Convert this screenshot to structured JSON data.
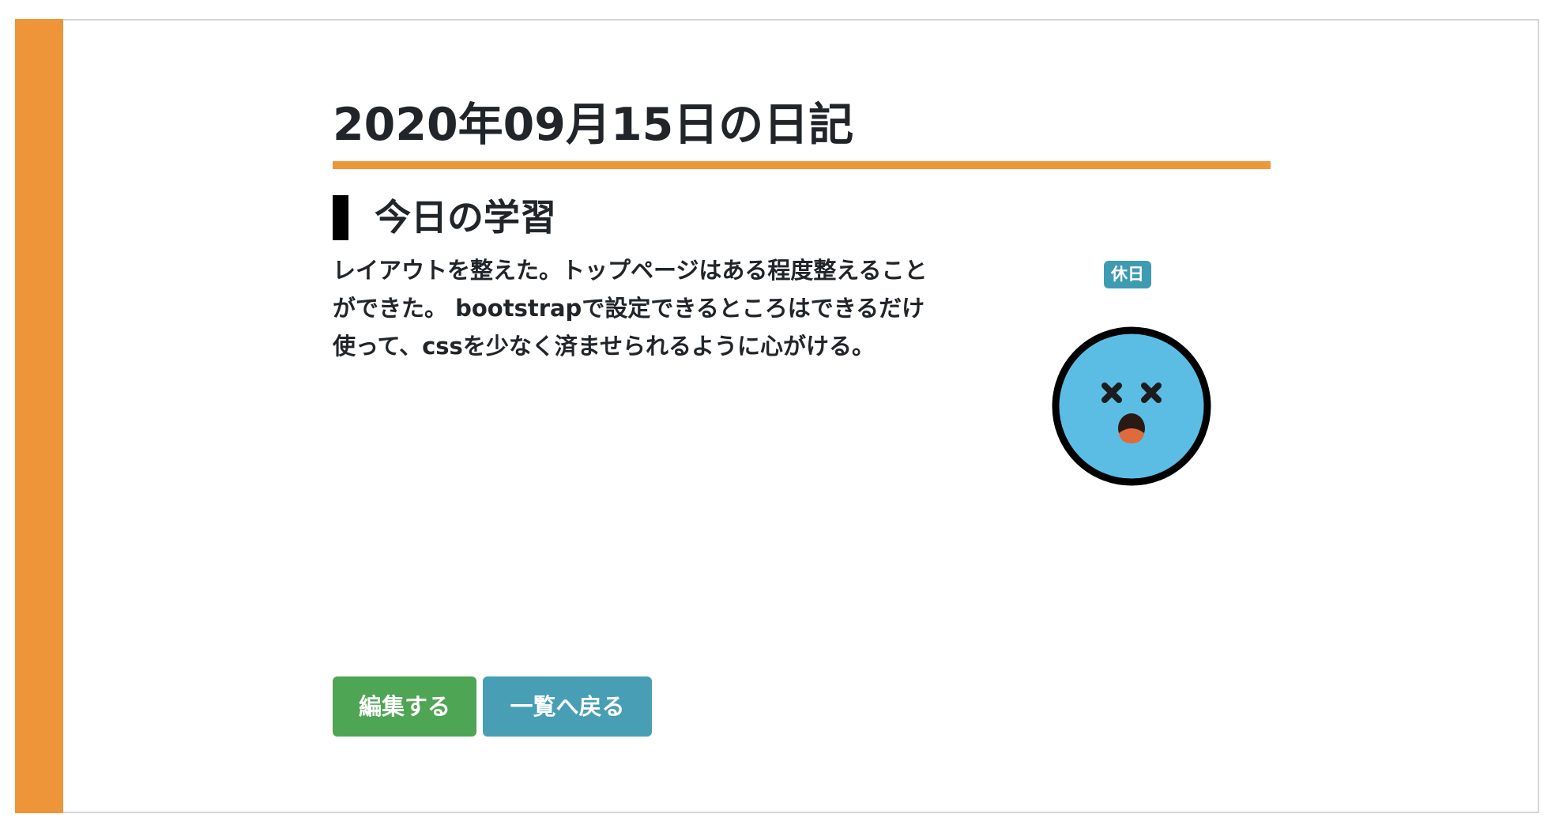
{
  "page": {
    "title": "2020年09月15日の日記"
  },
  "section": {
    "heading": "今日の学習",
    "body": "レイアウトを整えた。トップページはある程度整えることができた。 bootstrapで設定できるところはできるだけ使って、cssを少なく済ませられるように心がける。"
  },
  "status": {
    "badge": "休日",
    "mood_icon": "dizzy-face-icon"
  },
  "actions": {
    "edit_label": "編集する",
    "back_label": "一覧へ戻る"
  },
  "colors": {
    "accent": "#ef9539",
    "badge": "#3f9bb2",
    "edit_button": "#4ea553",
    "back_button": "#489fb5",
    "face": "#5bbde4"
  }
}
